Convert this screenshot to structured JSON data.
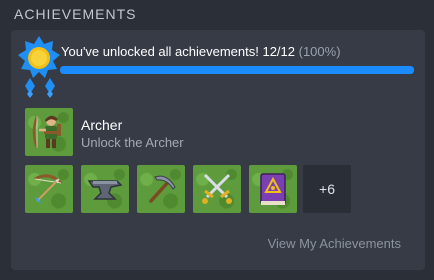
{
  "section": {
    "title": "ACHIEVEMENTS"
  },
  "summary": {
    "text": "You've unlocked all achievements! 12/12",
    "percent_label": "(100%)",
    "progress": 1.0
  },
  "featured": {
    "name": "Archer",
    "description": "Unlock the Archer",
    "icon": "archer-character-icon"
  },
  "tiles": [
    {
      "icon": "bow-and-arrow-icon"
    },
    {
      "icon": "anvil-icon"
    },
    {
      "icon": "pickaxe-icon"
    },
    {
      "icon": "crossed-swords-icon"
    },
    {
      "icon": "spellbook-icon"
    }
  ],
  "more": {
    "label": "+6"
  },
  "link": {
    "label": "View My Achievements"
  },
  "colors": {
    "accent": "#1a8cff",
    "tile_green": "#5d9b3c",
    "panel": "#363b46",
    "background": "#2b2f38"
  }
}
